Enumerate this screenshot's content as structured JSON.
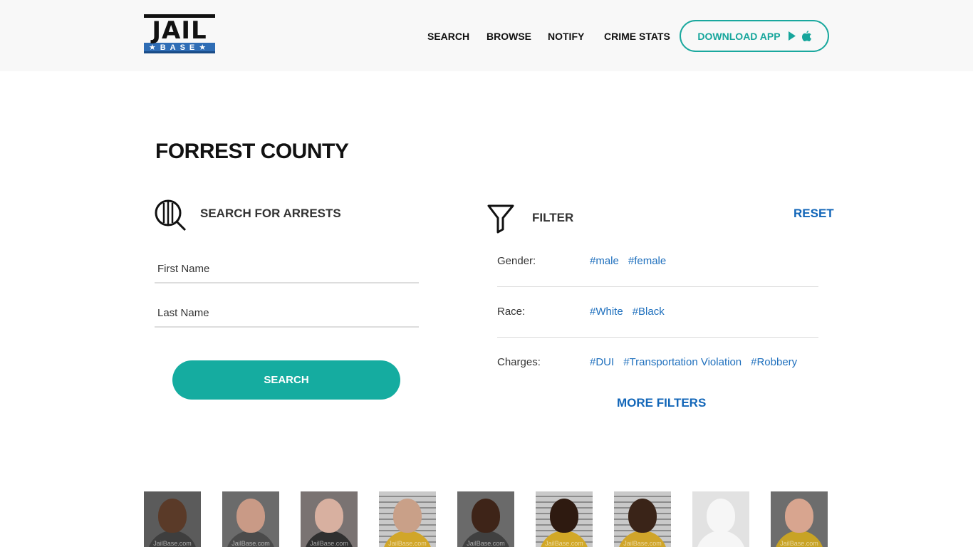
{
  "brand": {
    "logo_top": "JAIL",
    "logo_bottom": "★BASE★"
  },
  "nav": {
    "items": [
      "SEARCH",
      "BROWSE",
      "NOTIFY",
      "CRIME STATS"
    ],
    "download_label": "DOWNLOAD APP"
  },
  "page": {
    "title": "FORREST COUNTY"
  },
  "search": {
    "heading": "SEARCH FOR ARRESTS",
    "first_name_placeholder": "First Name",
    "last_name_placeholder": "Last Name",
    "button_label": "SEARCH"
  },
  "filter": {
    "heading": "FILTER",
    "reset_label": "RESET",
    "rows": [
      {
        "label": "Gender:",
        "tags": [
          "#male",
          "#female"
        ]
      },
      {
        "label": "Race:",
        "tags": [
          "#White",
          "#Black"
        ]
      },
      {
        "label": "Charges:",
        "tags": [
          "#DUI",
          "#Transportation Violation",
          "#Robbery"
        ]
      }
    ],
    "more_label": "MORE FILTERS"
  },
  "mugshots": {
    "watermark": "JailBase.com",
    "items": [
      {
        "style": "plain",
        "bg": "#5b5b5b",
        "skin": "#5a3a28",
        "shirt": "#3e3e3e"
      },
      {
        "style": "plain",
        "bg": "#6b6b6b",
        "skin": "#c99a86",
        "shirt": "#4b4b4b"
      },
      {
        "style": "plain",
        "bg": "#7a7372",
        "skin": "#d8b0a0",
        "shirt": "#303030"
      },
      {
        "style": "stripes",
        "bg": "#bdbdbd",
        "skin": "#c9a088",
        "shirt": "#d1a629"
      },
      {
        "style": "plain",
        "bg": "#6a6a6a",
        "skin": "#3e2418",
        "shirt": "#404040"
      },
      {
        "style": "stripes",
        "bg": "#bdbdbd",
        "skin": "#2e1a10",
        "shirt": "#d2a827"
      },
      {
        "style": "stripes",
        "bg": "#bdbdbd",
        "skin": "#3a2418",
        "shirt": "#d0a52a"
      },
      {
        "style": "placeholder",
        "bg": "#e2e2e2",
        "skin": "#f6f6f6",
        "shirt": "#f6f6f6"
      },
      {
        "style": "plain",
        "bg": "#6d6d6d",
        "skin": "#d8a58f",
        "shirt": "#c8a325"
      }
    ]
  }
}
